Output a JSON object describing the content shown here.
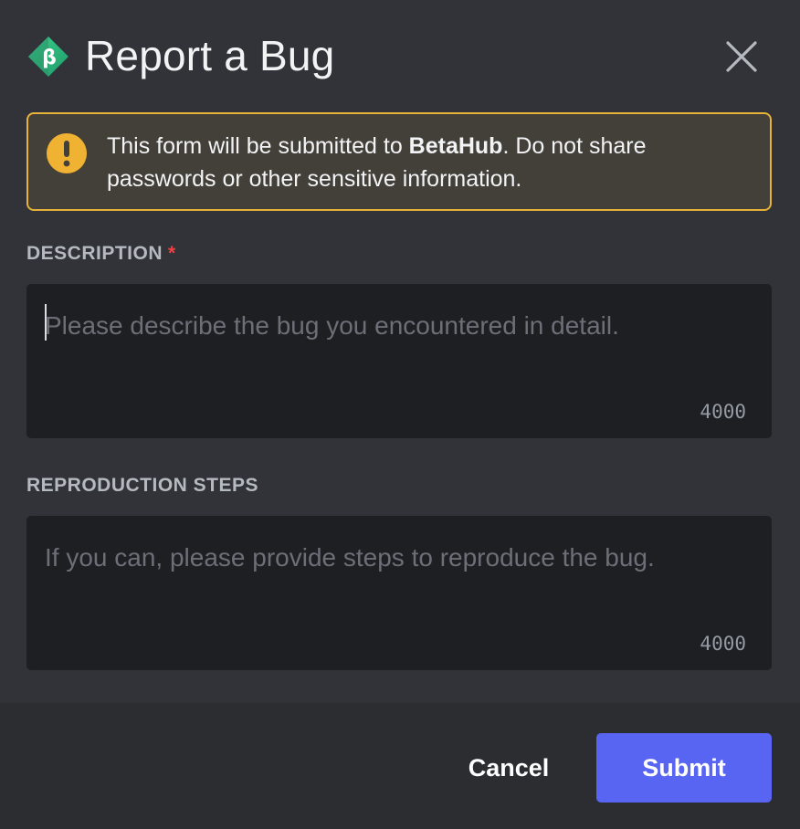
{
  "modal": {
    "title": "Report a Bug",
    "logo_icon": "betahub-beta-diamond-icon",
    "close_icon": "close-x-icon"
  },
  "notice": {
    "icon": "warning-exclamation-icon",
    "text_before": "This form will be submitted to ",
    "brand": "BetaHub",
    "text_after": ". Do not share passwords or other sensitive information."
  },
  "fields": {
    "description": {
      "label": "DESCRIPTION",
      "required_marker": "*",
      "value": "",
      "placeholder": "Please describe the bug you encountered in detail.",
      "char_counter": "4000"
    },
    "reproduction_steps": {
      "label": "REPRODUCTION STEPS",
      "value": "",
      "placeholder": "If you can, please provide steps to reproduce the bug.",
      "char_counter": "4000"
    }
  },
  "footer": {
    "cancel_label": "Cancel",
    "submit_label": "Submit"
  },
  "colors": {
    "background": "#313338",
    "footer_background": "#2b2d31",
    "input_background": "#1e1f22",
    "notice_border": "#e6b23a",
    "notice_background": "#43403a",
    "warning_icon": "#f0b232",
    "required": "#f23f43",
    "primary_button": "#5865f2",
    "logo_green": "#2fb97a"
  }
}
